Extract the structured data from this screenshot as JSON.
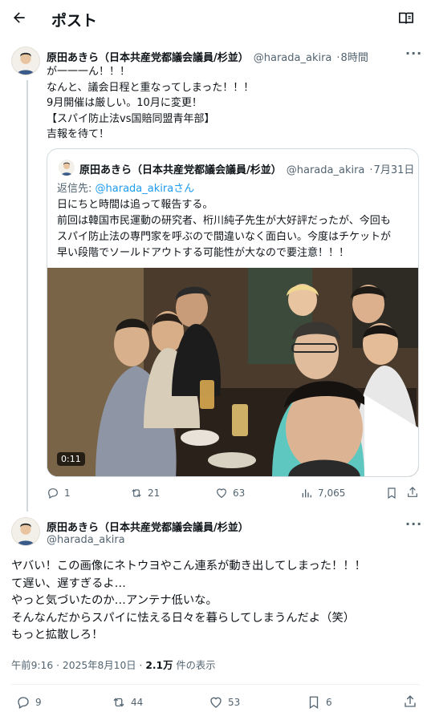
{
  "header": {
    "title": "ポスト"
  },
  "tweet1": {
    "name": "原田あきら（日本共産党都議会議員/杉並）",
    "handle": "@harada_akira",
    "time": "8時間",
    "lines": "が一一一ん！！！\nなんと、議会日程と重なってしまった！！！\n9月開催は厳しい。10月に変更！\n【スパイ防止法vs国賠同盟青年部】\n吉報を待て！",
    "quote": {
      "name": "原田あきら（日本共産党都議会議員/杉並）",
      "handle": "@harada_akira",
      "date": "7月31日",
      "reply_prefix": "返信先: ",
      "reply_to": "@harada_akiraさん",
      "body": "日にちと時間は追って報告する。\n前回は韓国市民運動の研究者、桁川純子先生が大好評だったが、今回も\nスパイ防止法の専門家を呼ぶので間違いなく面白い。今度はチケットが\n早い段階でソールドアウトする可能性が大なので要注意！！！",
      "video_duration": "0:11"
    },
    "stats": {
      "replies": "1",
      "reposts": "21",
      "likes": "63",
      "views": "7,065"
    }
  },
  "tweet2": {
    "name": "原田あきら（日本共産党都議会議員/杉並）",
    "handle": "@harada_akira",
    "body": "ヤバい！この画像にネトウヨやこん連系が動き出してしまった！！！\nて遅い、遅すぎるよ…\nやっと気づいたのか…アンテナ低いな。\nそんなんだからスパイに怯える日々を暮らしてしまうんだよ（笑）\nもっと拡散しろ！",
    "timestamp_prefix": "午前9:16 · 2025年8月10日 · ",
    "views_count": "2.1万",
    "views_suffix": " 件の表示",
    "stats": {
      "replies": "9",
      "reposts": "44",
      "likes": "53",
      "bookmarks": "6"
    }
  },
  "colors": {
    "accent": "#1d9bf0",
    "secondary_text": "#536471",
    "border": "#cfd9de"
  }
}
